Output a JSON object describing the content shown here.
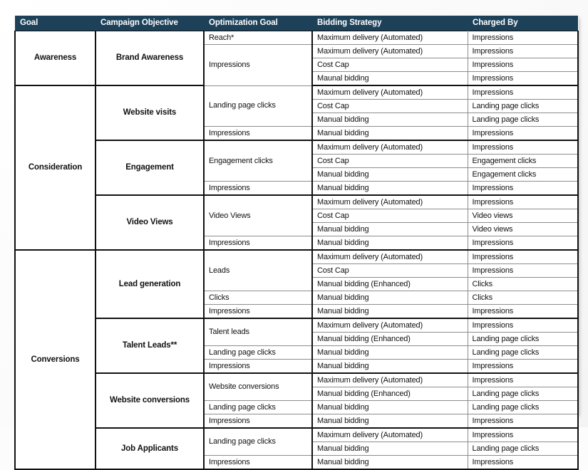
{
  "table": {
    "headers": [
      "Goal",
      "Campaign Objective",
      "Optimization Goal",
      "Bidding Strategy",
      "Charged By"
    ],
    "rows": [
      {
        "goal": "Awareness",
        "goal_span": 4,
        "objective": "Brand Awareness",
        "objective_span": 4,
        "optimization": "Reach*",
        "optimization_span": 1,
        "bidding": "Maximum delivery (Automated)",
        "charged": "Impressions"
      },
      {
        "optimization": "Impressions",
        "optimization_span": 3,
        "bidding": "Maximum delivery (Automated)",
        "charged": "Impressions"
      },
      {
        "bidding": "Cost Cap",
        "charged": "Impressions"
      },
      {
        "bidding": "Maunal bidding",
        "charged": "Impressions",
        "objective_end": true,
        "goal_end": true
      },
      {
        "goal": "Consideration",
        "goal_span": 12,
        "objective": "Website visits",
        "objective_span": 4,
        "optimization": "Landing page clicks",
        "optimization_span": 3,
        "bidding": "Maximum delivery (Automated)",
        "charged": "Impressions"
      },
      {
        "bidding": "Cost Cap",
        "charged": "Landing page clicks"
      },
      {
        "bidding": "Manual bidding",
        "charged": "Landing page clicks"
      },
      {
        "optimization": "Impressions",
        "optimization_span": 1,
        "bidding": "Manual bidding",
        "charged": "Impressions",
        "objective_end": true
      },
      {
        "objective": "Engagement",
        "objective_span": 4,
        "optimization": "Engagement clicks",
        "optimization_span": 3,
        "bidding": "Maximum delivery (Automated)",
        "charged": "Impressions"
      },
      {
        "bidding": "Cost Cap",
        "charged": "Engagement clicks"
      },
      {
        "bidding": "Manual bidding",
        "charged": "Engagement clicks"
      },
      {
        "optimization": "Impressions",
        "optimization_span": 1,
        "bidding": "Manual bidding",
        "charged": "Impressions",
        "objective_end": true
      },
      {
        "objective": "Video Views",
        "objective_span": 4,
        "optimization": "Video Views",
        "optimization_span": 3,
        "bidding": "Maximum delivery (Automated)",
        "charged": "Impressions"
      },
      {
        "bidding": "Cost Cap",
        "charged": "Video views"
      },
      {
        "bidding": "Manual bidding",
        "charged": "Video views"
      },
      {
        "optimization": "Impressions",
        "optimization_span": 1,
        "bidding": "Manual bidding",
        "charged": "Impressions",
        "objective_end": true,
        "goal_end": true
      },
      {
        "goal": "Conversions",
        "goal_span": 16,
        "objective": "Lead generation",
        "objective_span": 5,
        "optimization": "Leads",
        "optimization_span": 3,
        "bidding": "Maximum delivery (Automated)",
        "charged": "Impressions"
      },
      {
        "bidding": "Cost Cap",
        "charged": "Impressions"
      },
      {
        "bidding": "Manual bidding (Enhanced)",
        "charged": "Clicks"
      },
      {
        "optimization": "Clicks",
        "optimization_span": 1,
        "bidding": "Manual bidding",
        "charged": "Clicks"
      },
      {
        "optimization": "Impressions",
        "optimization_span": 1,
        "bidding": "Manual bidding",
        "charged": "Impressions",
        "objective_end": true
      },
      {
        "objective": "Talent Leads**",
        "objective_span": 4,
        "optimization": "Talent leads",
        "optimization_span": 2,
        "bidding": "Maximum delivery (Automated)",
        "charged": "Impressions"
      },
      {
        "bidding": "Manual bidding (Enhanced)",
        "charged": "Landing page clicks"
      },
      {
        "optimization": "Landing page clicks",
        "optimization_span": 1,
        "bidding": "Manual bidding",
        "charged": "Landing page clicks"
      },
      {
        "optimization": "Impressions",
        "optimization_span": 1,
        "bidding": "Manual bidding",
        "charged": "Impressions",
        "objective_end": true
      },
      {
        "objective": "Website conversions",
        "objective_span": 4,
        "optimization": "Website conversions",
        "optimization_span": 2,
        "bidding": "Maximum delivery (Automated)",
        "charged": "Impressions"
      },
      {
        "bidding": "Manual bidding (Enhanced)",
        "charged": "Landing page clicks"
      },
      {
        "optimization": "Landing page clicks",
        "optimization_span": 1,
        "bidding": "Manual bidding",
        "charged": "Landing page clicks"
      },
      {
        "optimization": "Impressions",
        "optimization_span": 1,
        "bidding": "Manual bidding",
        "charged": "Impressions",
        "objective_end": true
      },
      {
        "objective": "Job Applicants",
        "objective_span": 3,
        "optimization": "Landing page clicks",
        "optimization_span": 2,
        "bidding": "Maximum delivery (Automated)",
        "charged": "Impressions"
      },
      {
        "bidding": "Manual bidding",
        "charged": "Landing page clicks"
      },
      {
        "optimization": "Impressions",
        "optimization_span": 1,
        "bidding": "Manual bidding",
        "charged": "Impressions",
        "objective_end": true,
        "goal_end": true
      }
    ]
  },
  "colors": {
    "header_bg": "#1d4159",
    "header_text": "#ffffff",
    "body_text": "#111111",
    "grid_line": "#8d8d8d",
    "heavy_line": "#111111",
    "page_bg": "#fcfcfc"
  }
}
